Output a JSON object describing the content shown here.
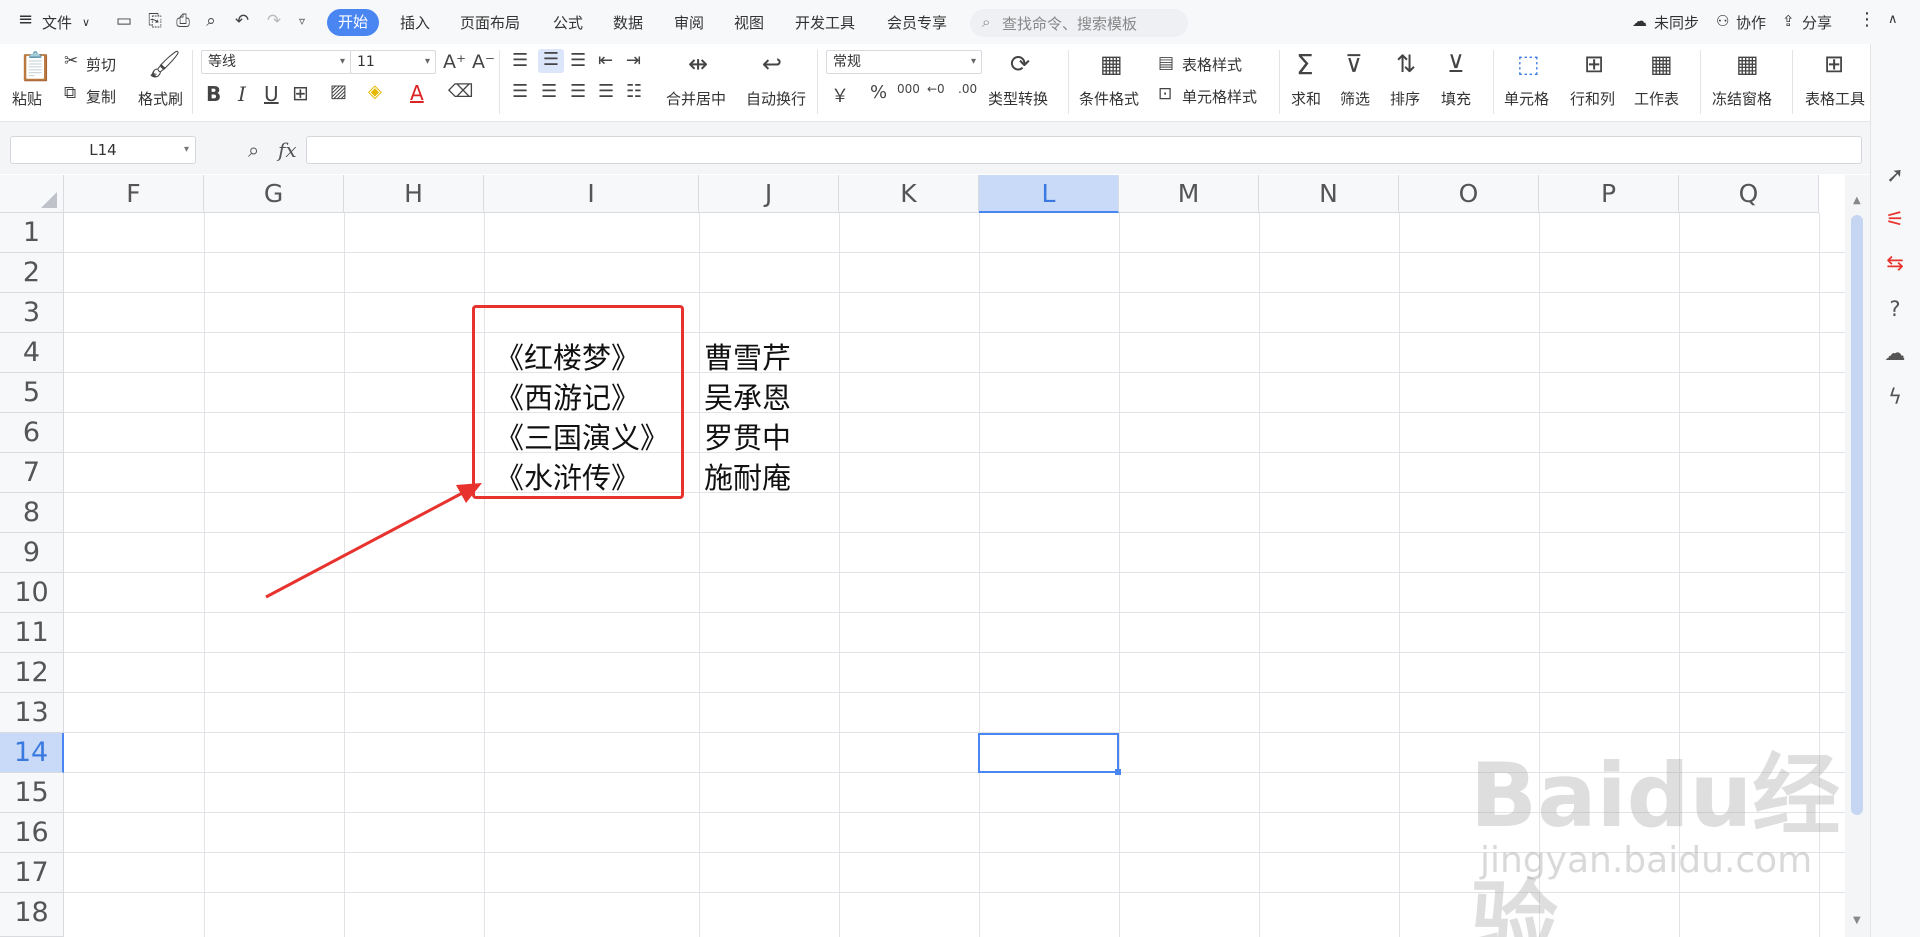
{
  "menu": {
    "file": "文件",
    "tabs": [
      "开始",
      "插入",
      "页面布局",
      "公式",
      "数据",
      "审阅",
      "视图",
      "开发工具",
      "会员专享"
    ],
    "search_placeholder": "查找命令、搜索模板",
    "sync": "未同步",
    "collab": "协作",
    "share": "分享"
  },
  "ribbon": {
    "paste": "粘贴",
    "cut": "剪切",
    "copy": "复制",
    "format_painter": "格式刷",
    "font_name": "等线",
    "font_size": "11",
    "merge_center": "合并居中",
    "wrap_text": "自动换行",
    "number_format": "常规",
    "type_convert": "类型转换",
    "cond_format": "条件格式",
    "table_style": "表格样式",
    "cell_style": "单元格样式",
    "sum": "求和",
    "filter": "筛选",
    "sort": "排序",
    "fill": "填充",
    "cell": "单元格",
    "row_col": "行和列",
    "sheet": "工作表",
    "freeze": "冻结窗格",
    "table_tools": "表格工具",
    "bold": "B",
    "italic": "I",
    "underline": "U",
    "font_color_glyph": "A",
    "currency_glyph": "￥",
    "percent_glyph": "%"
  },
  "formula": {
    "name_box": "L14",
    "fx": "fx"
  },
  "grid": {
    "columns": [
      "F",
      "G",
      "H",
      "I",
      "J",
      "K",
      "L",
      "M",
      "N",
      "O",
      "P",
      "Q"
    ],
    "selected_column": "L",
    "rows": [
      "1",
      "2",
      "3",
      "4",
      "5",
      "6",
      "7",
      "8",
      "9",
      "10",
      "11",
      "12",
      "13",
      "14",
      "15",
      "16",
      "17",
      "18"
    ],
    "selected_row": "14",
    "books": [
      "《红楼梦》",
      "《西游记》",
      "《三国演义》",
      "《水浒传》"
    ],
    "authors": [
      "曹雪芹",
      "吴承恩",
      "罗贯中",
      "施耐庵"
    ]
  },
  "colors": {
    "accent": "#4a86f2",
    "annotation_red": "#e8322e"
  },
  "watermark": {
    "brand": "Baidu经验",
    "url": "jingyan.baidu.com"
  }
}
